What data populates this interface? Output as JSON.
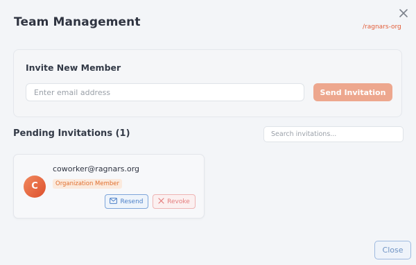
{
  "header": {
    "title": "Team Management",
    "org_link": "/ragnars-org",
    "close_icon": "close-icon"
  },
  "invite": {
    "title": "Invite New Member",
    "email_placeholder": "Enter email address",
    "email_value": "",
    "send_label": "Send Invitation"
  },
  "pending": {
    "title": "Pending Invitations (1)",
    "search_placeholder": "Search invitations...",
    "invitations": [
      {
        "avatar_letter": "C",
        "email": "coworker@ragnars.org",
        "role": "Organization Member",
        "resend_label": "Resend",
        "resend_icon": "mail-icon",
        "revoke_label": "Revoke",
        "revoke_icon": "x-icon"
      }
    ]
  },
  "footer": {
    "close_label": "Close"
  },
  "colors": {
    "accent": "#e25b36",
    "send_button": "#eda78e",
    "resend": "#4b7fc7",
    "revoke": "#e47d7d"
  }
}
